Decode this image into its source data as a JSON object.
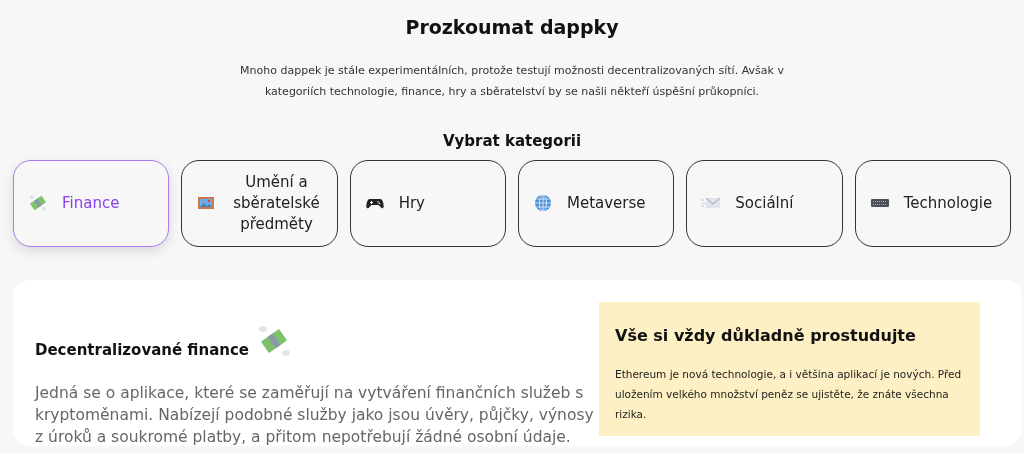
{
  "title": "Prozkoumat dappky",
  "intro": "Mnoho dappek je stále experimentálních, protože testují možnosti decentralizovaných sítí. Avšak v kategoriích technologie, finance, hry a sběratelství by se našli někteří úspěšní průkopníci.",
  "category_heading": "Vybrat kategorii",
  "categories": [
    {
      "label": "Finance",
      "kind": "money",
      "selected": true
    },
    {
      "label": "Umění a sběratelské předměty",
      "kind": "painting",
      "selected": false
    },
    {
      "label": "Hry",
      "kind": "gamepad",
      "selected": false
    },
    {
      "label": "Metaverse",
      "kind": "globe",
      "selected": false
    },
    {
      "label": "Sociální",
      "kind": "envelope",
      "selected": false
    },
    {
      "label": "Technologie",
      "kind": "keyboard",
      "selected": false
    }
  ],
  "detail": {
    "title": "Decentralizované finance",
    "text": "Jedná se o aplikace, které se zaměřují na vytváření finančních služeb s kryptoměnami. Nabízejí podobné služby jako jsou úvěry, půjčky, výnosy z úroků a soukromé platby, a přitom nepotřebují žádné osobní údaje."
  },
  "warning": {
    "title": "Vše si vždy důkladně prostudujte",
    "text": "Ethereum je nová technologie, a i většina aplikací je nových. Před uložením velkého množství peněz se ujistěte, že znáte všechna rizika."
  }
}
